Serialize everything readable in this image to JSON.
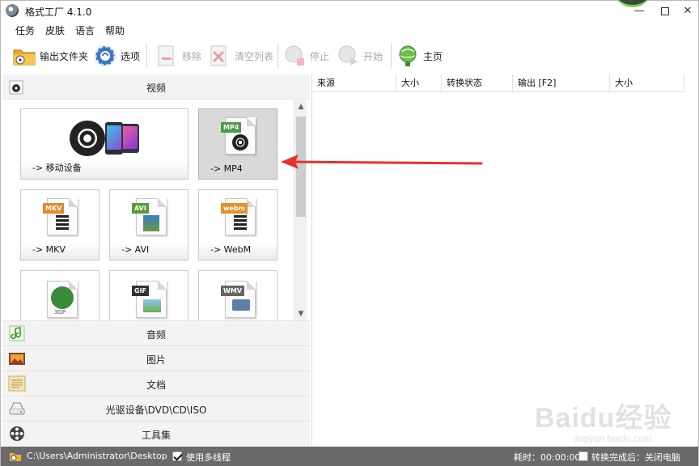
{
  "window": {
    "title": "格式工厂 4.1.0",
    "controls": {
      "minimize": "—",
      "maximize": "",
      "close": "✕"
    }
  },
  "menu": [
    "任务",
    "皮肤",
    "语言",
    "帮助"
  ],
  "toolbar": {
    "output_folder": "输出文件夹",
    "options": "选项",
    "remove": "移除",
    "clear_list": "清空列表",
    "stop": "停止",
    "start": "开始",
    "home": "主页"
  },
  "categories": {
    "video": "视频",
    "audio": "音频",
    "image": "图片",
    "document": "文档",
    "rom": "光驱设备\\DVD\\CD\\ISO",
    "tools": "工具集"
  },
  "video_tiles": [
    {
      "label": "-> 移动设备"
    },
    {
      "label": "-> MP4",
      "badge": "MP4",
      "badge_color": "#4a9c4a"
    },
    {
      "label": "-> MKV",
      "badge": "MKV",
      "badge_color": "#e08a2a"
    },
    {
      "label": "-> AVI",
      "badge": "AVI",
      "badge_color": "#5a9a3a"
    },
    {
      "label": "-> WebM",
      "badge": "webm",
      "badge_color": "#e6902a"
    },
    {
      "label": "",
      "badge": "3GP",
      "badge_color": "#3b8b3b"
    },
    {
      "label": "",
      "badge": "GIF",
      "badge_color": "#333333"
    },
    {
      "label": "",
      "badge": "WMV",
      "badge_color": "#666666"
    }
  ],
  "task_columns": [
    "来源",
    "大小",
    "转换状态",
    "输出 [F2]",
    "大小"
  ],
  "statusbar": {
    "path": "C:\\Users\\Administrator\\Desktop",
    "multithread": "使用多线程",
    "multithread_checked": true,
    "elapsed": "耗时：00:00:00",
    "after_done": "转换完成后：关闭电脑",
    "after_done_checked": false
  },
  "watermark": {
    "main": "Baidu经验",
    "sub": "jingyan.baidu.com"
  },
  "colors": {
    "annotation_arrow": "#e8312f",
    "selected_tile": "#d9d9d9",
    "statusbar": "#6a6a6a"
  }
}
